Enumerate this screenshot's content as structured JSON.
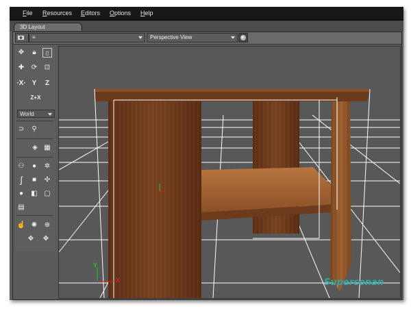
{
  "menu": {
    "items": [
      "File",
      "Resources",
      "Editors",
      "Options",
      "Help"
    ]
  },
  "tabs": {
    "active": "3D Layout"
  },
  "toolbar": {
    "view_mode": "Perspective View"
  },
  "tools": {
    "axis_label": "Z+X",
    "coord_system": "World"
  },
  "viewport": {
    "gizmo_labels": {
      "y": "Y",
      "x": "X"
    }
  },
  "watermark": "Superconan",
  "colors": {
    "wood_dark": "#6e3a1c",
    "wood_light": "#9a5a2c",
    "grid": "#ffffff",
    "watermark": "#33a7a7"
  }
}
